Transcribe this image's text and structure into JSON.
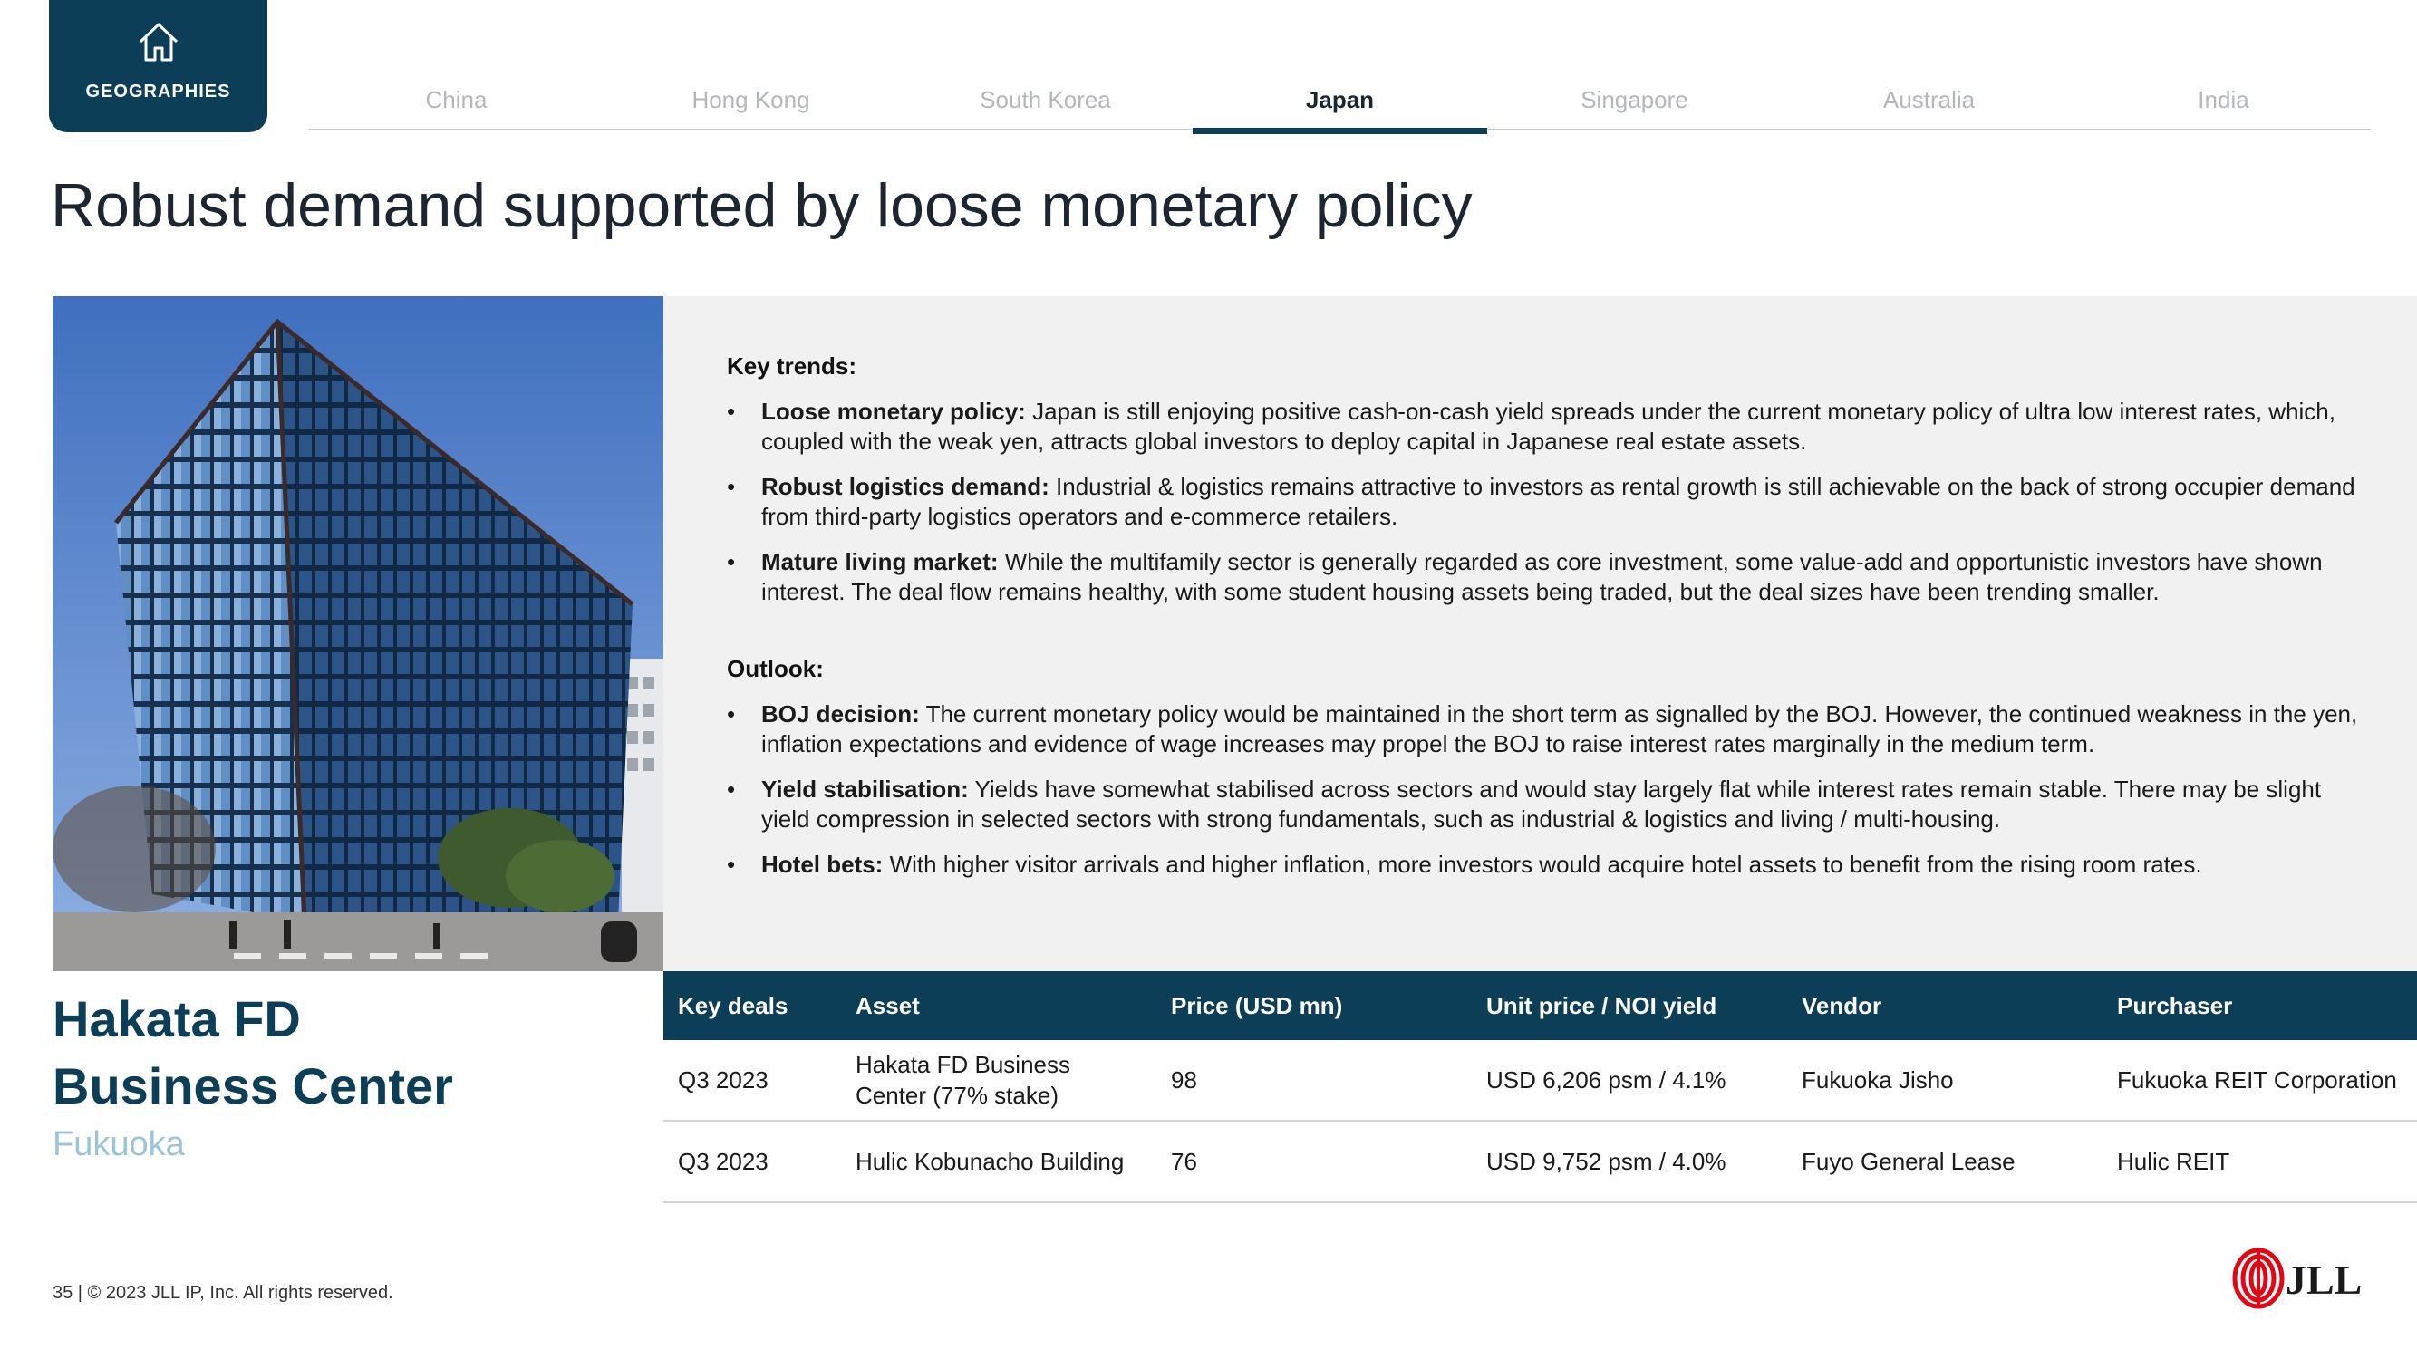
{
  "nav": {
    "home_label": "GEOGRAPHIES",
    "tabs": [
      {
        "label": "China"
      },
      {
        "label": "Hong Kong"
      },
      {
        "label": "South Korea"
      },
      {
        "label": "Japan",
        "active": true
      },
      {
        "label": "Singapore"
      },
      {
        "label": "Australia"
      },
      {
        "label": "India"
      }
    ]
  },
  "page_title": "Robust demand supported by loose monetary policy",
  "key_trends": {
    "heading": "Key trends:",
    "items": [
      {
        "bold": "Loose monetary policy:",
        "text": " Japan is still enjoying positive cash-on-cash yield spreads under the current monetary policy of ultra low interest rates, which, coupled with the weak yen, attracts global investors to deploy capital in Japanese real estate assets."
      },
      {
        "bold": "Robust logistics demand:",
        "text": " Industrial & logistics remains attractive to investors as rental growth is still achievable on the back of strong occupier demand from third-party logistics operators and e-commerce retailers."
      },
      {
        "bold": "Mature living market:",
        "text": " While the multifamily sector is generally regarded as core investment, some value-add and opportunistic investors have shown interest. The deal flow remains healthy, with some student housing assets being traded, but the deal sizes have been trending smaller."
      }
    ]
  },
  "outlook": {
    "heading": "Outlook:",
    "items": [
      {
        "bold": "BOJ decision:",
        "text": " The current monetary policy would be maintained in the short term as signalled by the BOJ. However, the continued weakness in the yen, inflation expectations and evidence of wage increases may propel the BOJ to raise interest rates marginally in the medium term."
      },
      {
        "bold": "Yield stabilisation:",
        "text": " Yields have somewhat stabilised across sectors and would stay largely flat while interest rates remain stable. There may be slight yield compression in selected sectors with strong fundamentals, such as industrial & logistics and living / multi-housing."
      },
      {
        "bold": "Hotel bets:",
        "text": " With higher visitor arrivals and higher inflation, more investors would acquire hotel assets to benefit from the rising room rates."
      }
    ]
  },
  "asset": {
    "name_line1": "Hakata FD",
    "name_line2": "Business Center",
    "city": "Fukuoka"
  },
  "deals_table": {
    "headers": [
      "Key deals",
      "Asset",
      "Price (USD mn)",
      "Unit price / NOI yield",
      "Vendor",
      "Purchaser"
    ],
    "rows": [
      [
        "Q3 2023",
        "Hakata FD Business Center (77% stake)",
        "98",
        "USD 6,206 psm / 4.1%",
        "Fukuoka Jisho",
        "Fukuoka REIT Corporation"
      ],
      [
        "Q3 2023",
        "Hulic Kobunacho Building",
        "76",
        "USD 9,752 psm / 4.0%",
        "Fuyo General Lease",
        "Hulic REIT"
      ]
    ]
  },
  "footer": "35  |  © 2023 JLL IP, Inc. All rights reserved.",
  "logo_text": "JLL",
  "colors": {
    "brand_navy": "#0c3f57",
    "brand_red": "#e30613",
    "city_blue": "#9ac4d8",
    "panel_grey": "#f1f1f1"
  },
  "icons": {
    "home": "house-icon"
  }
}
